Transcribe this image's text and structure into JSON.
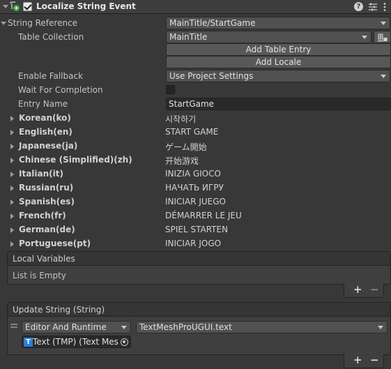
{
  "header": {
    "title": "Localize String Event",
    "enabled": true,
    "icons": [
      "script-icon",
      "help-icon",
      "presets-icon",
      "kebab-icon"
    ]
  },
  "string_reference": {
    "label": "String Reference",
    "value": "MainTitle/StartGame",
    "table_collection_label": "Table Collection",
    "table_collection_value": "MainTitle",
    "add_table_entry": "Add Table Entry",
    "add_locale": "Add Locale",
    "enable_fallback_label": "Enable Fallback",
    "enable_fallback_value": "Use Project Settings",
    "wait_label": "Wait For Completion",
    "wait_checked": false,
    "entry_name_label": "Entry Name",
    "entry_name_value": "StartGame"
  },
  "locales": [
    {
      "name": "Korean(ko)",
      "value": "시작하기"
    },
    {
      "name": "English(en)",
      "value": "START GAME"
    },
    {
      "name": "Japanese(ja)",
      "value": "ゲーム開始"
    },
    {
      "name": "Chinese (Simplified)(zh)",
      "value": "开始游戏"
    },
    {
      "name": "Italian(it)",
      "value": "INIZIA GIOCO"
    },
    {
      "name": "Russian(ru)",
      "value": "НАЧАТЬ ИГРУ"
    },
    {
      "name": "Spanish(es)",
      "value": "INICIAR JUEGO"
    },
    {
      "name": "French(fr)",
      "value": "DÉMARRER LE JEU"
    },
    {
      "name": "German(de)",
      "value": "SPIEL STARTEN"
    },
    {
      "name": "Portuguese(pt)",
      "value": "INICIAR JOGO"
    }
  ],
  "local_variables": {
    "title": "Local Variables",
    "empty_text": "List is Empty",
    "add": "+",
    "remove": "−"
  },
  "update_string": {
    "title": "Update String (String)",
    "runtime_value": "Editor And Runtime",
    "function_value": "TextMeshProUGUI.text",
    "object_value": "Text (TMP) (Text Mes",
    "add": "+",
    "remove": "−"
  },
  "colors": {
    "background": "#383838",
    "header": "#3e3e3e",
    "accent_green": "#3fae4c",
    "tmp_blue": "#2b7fd6"
  }
}
